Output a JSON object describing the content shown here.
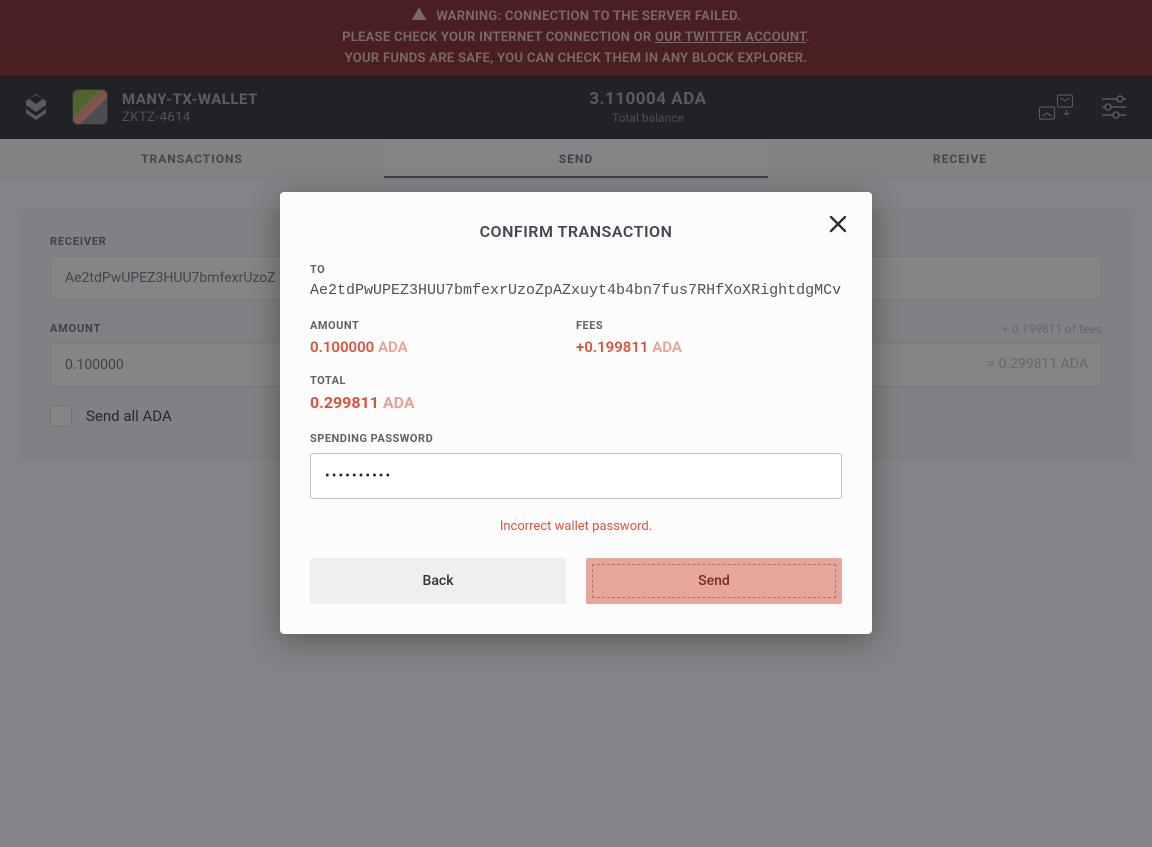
{
  "warning": {
    "line1": "WARNING: CONNECTION TO THE SERVER FAILED.",
    "line2a": "PLEASE CHECK YOUR INTERNET CONNECTION OR ",
    "twitter_link": "OUR TWITTER ACCOUNT",
    "line2b": ".",
    "line3": "YOUR FUNDS ARE SAFE, YOU CAN CHECK THEM IN ANY BLOCK EXPLORER."
  },
  "header": {
    "wallet_name": "MANY-TX-WALLET",
    "wallet_id": "ZKTZ-4614",
    "balance": "3.110004 ADA",
    "balance_label": "Total balance"
  },
  "tabs": {
    "transactions": "TRANSACTIONS",
    "send": "SEND",
    "receive": "RECEIVE"
  },
  "send_form": {
    "receiver_label": "RECEIVER",
    "receiver_value": "Ae2tdPwUPEZ3HUU7bmfexrUzoZ",
    "amount_label": "AMOUNT",
    "amount_value": "0.100000",
    "fees_hint": "+ 0.199811 of fees",
    "equals_total": "= 0.299811 ADA",
    "send_all_label": "Send all ADA"
  },
  "modal": {
    "title": "CONFIRM TRANSACTION",
    "to_label": "TO",
    "to_address": "Ae2tdPwUPEZ3HUU7bmfexrUzoZpAZxuyt4b4bn7fus7RHfXoXRightdgMCv",
    "amount_label": "AMOUNT",
    "amount_value": "0.100000",
    "amount_unit": "ADA",
    "fees_label": "FEES",
    "fees_value": "+0.199811",
    "fees_unit": "ADA",
    "total_label": "TOTAL",
    "total_value": "0.299811",
    "total_unit": "ADA",
    "pw_label": "SPENDING PASSWORD",
    "pw_value": "••••••••••",
    "error": "Incorrect wallet password.",
    "back": "Back",
    "send": "Send"
  }
}
